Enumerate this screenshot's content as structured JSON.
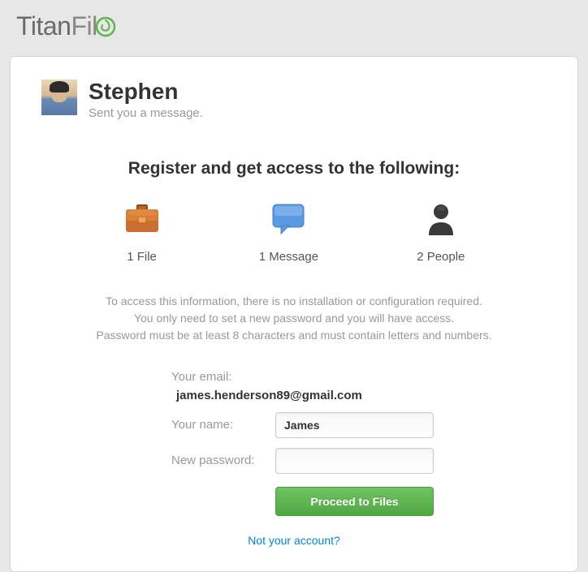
{
  "brand": {
    "part1": "Titan",
    "part2": "Fil"
  },
  "sender": {
    "name": "Stephen",
    "subtext": "Sent you a message."
  },
  "register_heading": "Register and get access to the following:",
  "access": {
    "file": {
      "label": "1 File"
    },
    "message": {
      "label": "1 Message"
    },
    "people": {
      "label": "2 People"
    }
  },
  "info": {
    "line1": "To access this information, there is no installation or configuration required.",
    "line2": "You only need to set a new password and you will have access.",
    "line3": "Password must be at least 8 characters and must contain letters and numbers."
  },
  "form": {
    "email_label": "Your email:",
    "email_value": "james.henderson89@gmail.com",
    "name_label": "Your name:",
    "name_value": "James",
    "password_label": "New password:",
    "password_value": ""
  },
  "buttons": {
    "proceed": "Proceed to Files"
  },
  "links": {
    "not_account": "Not your account?"
  }
}
